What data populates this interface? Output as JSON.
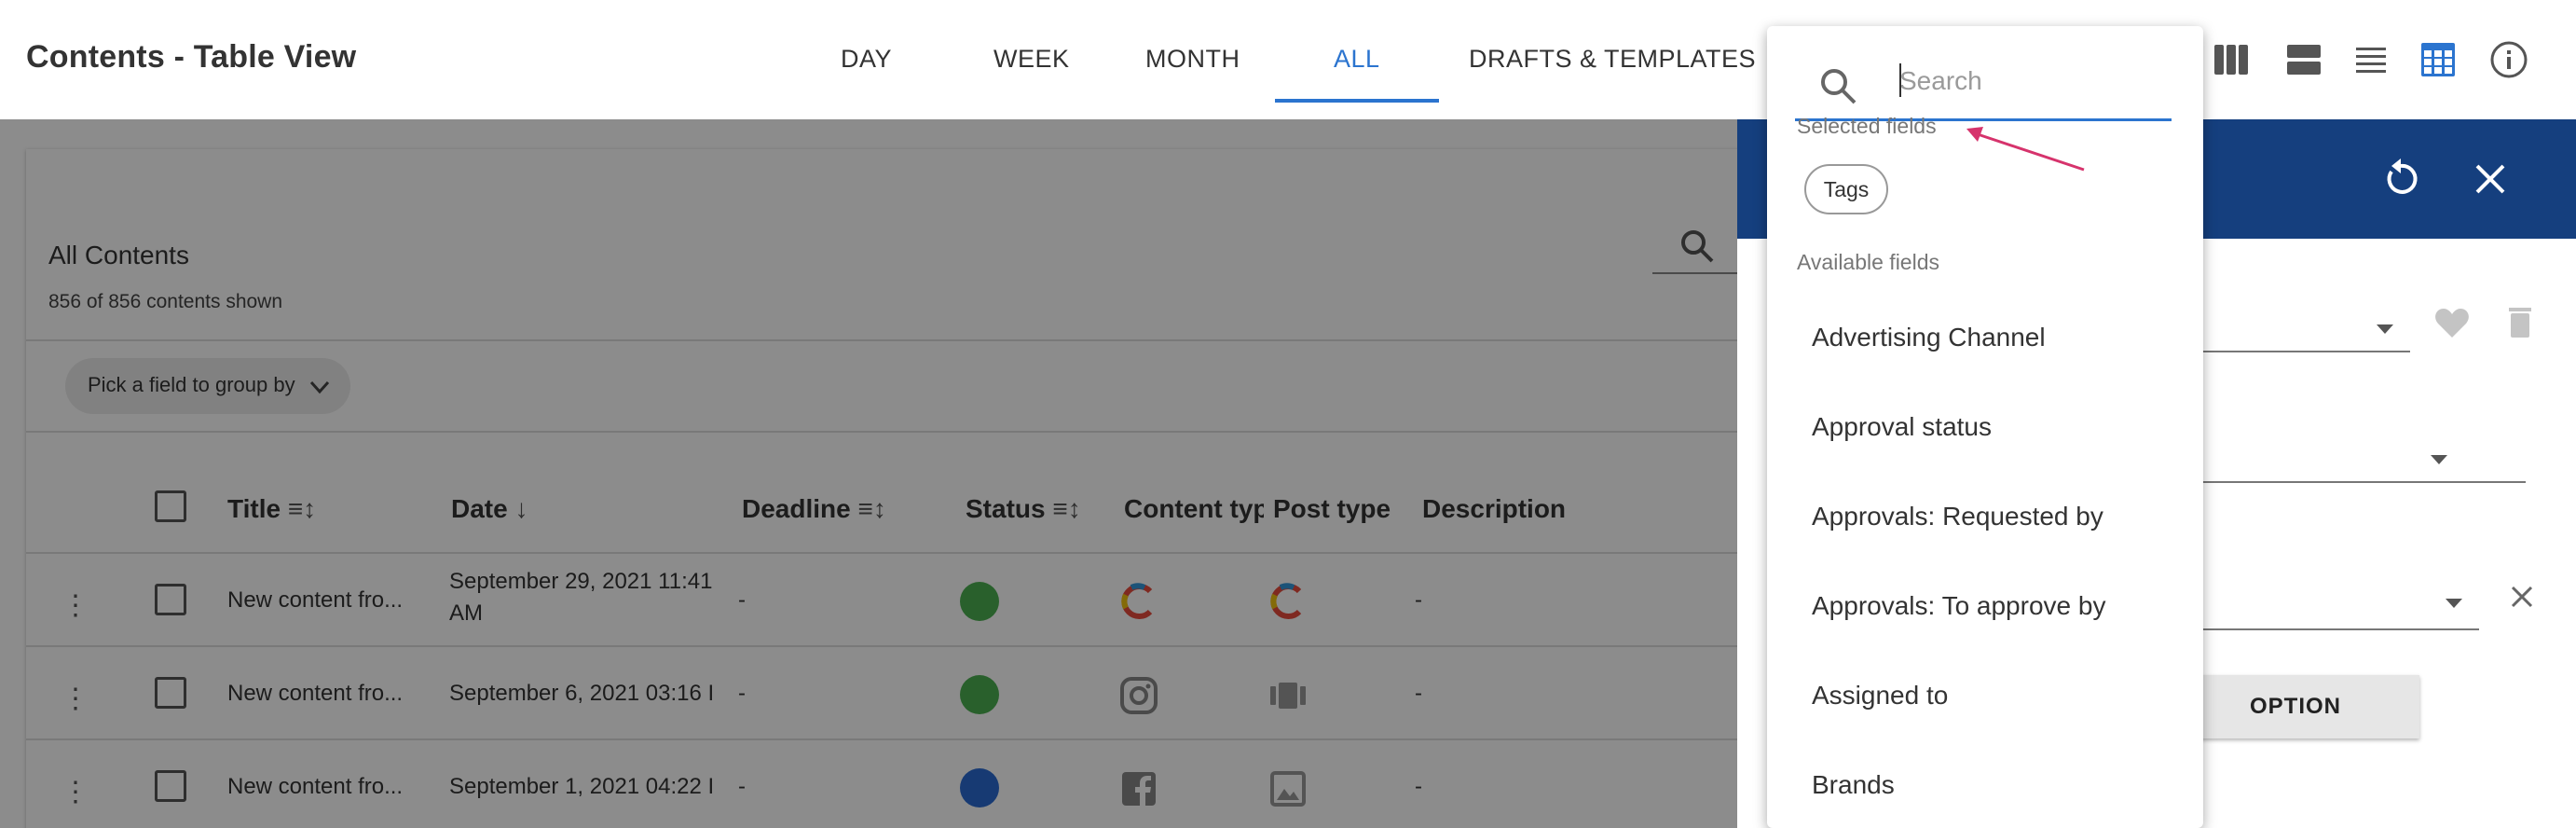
{
  "header": {
    "title": "Contents - Table View",
    "tabs": [
      {
        "label": "DAY",
        "active": false
      },
      {
        "label": "WEEK",
        "active": false
      },
      {
        "label": "MONTH",
        "active": false
      },
      {
        "label": "ALL",
        "active": true
      },
      {
        "label": "DRAFTS & TEMPLATES",
        "active": false
      }
    ],
    "view_icons": [
      "columns-view-icon",
      "rows-view-icon",
      "list-view-icon",
      "table-view-icon",
      "info-icon"
    ],
    "accent_color": "#2b74cf"
  },
  "table_card": {
    "title": "All Contents",
    "count_text": "856 of 856 contents shown",
    "group_by_label": "Pick a field to group by",
    "columns": [
      "Title",
      "Date",
      "Deadline",
      "Status",
      "Content typ",
      "Post type",
      "Description"
    ],
    "rows": [
      {
        "title": "New content fro...",
        "date_line1": "September 29, 2021 11:41",
        "date_line2": "AM",
        "deadline": "-",
        "status_color": "#4caf50",
        "content_type_icon": "brand-logo-icon",
        "post_type_icon": "brand-logo-icon",
        "description": "-"
      },
      {
        "title": "New content fro...",
        "date_line1": "September 6, 2021 03:16 I",
        "date_line2": "",
        "deadline": "-",
        "status_color": "#4caf50",
        "content_type_icon": "instagram-icon",
        "post_type_icon": "carousel-icon",
        "description": "-"
      },
      {
        "title": "New content fro...",
        "date_line1": "September 1, 2021 04:22 I",
        "date_line2": "",
        "deadline": "-",
        "status_color": "#2a6bd1",
        "content_type_icon": "facebook-icon",
        "post_type_icon": "image-icon",
        "description": "-"
      }
    ]
  },
  "side_panel": {
    "header_color": "#153f7e",
    "button_label": "OPTION"
  },
  "field_picker": {
    "search_placeholder": "Search",
    "selected_label": "Selected fields",
    "selected_fields": [
      "Tags"
    ],
    "available_label": "Available fields",
    "available_fields": [
      "Advertising Channel",
      "Approval status",
      "Approvals: Requested by",
      "Approvals: To approve by",
      "Assigned to",
      "Brands"
    ],
    "annotation_arrow_color": "#d6336c"
  }
}
